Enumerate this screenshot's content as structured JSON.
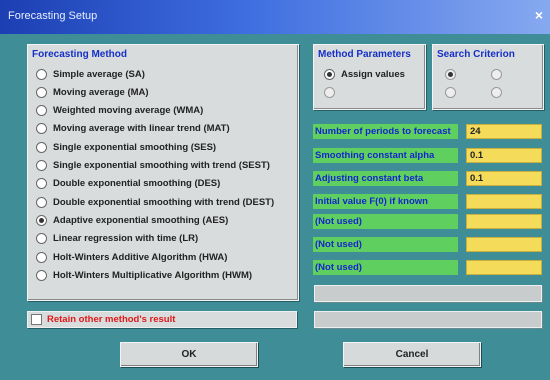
{
  "window": {
    "title": "Forecasting Setup",
    "close_label": "×"
  },
  "method_group": {
    "label": "Forecasting Method",
    "selected_index": 8,
    "options": [
      "Simple average (SA)",
      "Moving average (MA)",
      "Weighted moving average (WMA)",
      "Moving average with linear trend (MAT)",
      "Single exponential smoothing (SES)",
      "Single exponential smoothing with trend (SEST)",
      "Double exponential smoothing (DES)",
      "Double exponential smoothing with trend (DEST)",
      "Adaptive exponential smoothing (AES)",
      "Linear regression with time (LR)",
      "Holt-Winters Additive Algorithm (HWA)",
      "Holt-Winters Multiplicative Algorithm (HWM)"
    ]
  },
  "method_params": {
    "label": "Method Parameters",
    "option_assign": "Assign values",
    "option_search": ""
  },
  "search_criterion": {
    "label": "Search Criterion",
    "opt1": "",
    "opt2": "",
    "opt3": "",
    "opt4": ""
  },
  "params": {
    "rows": [
      {
        "label": "Number of periods to forecast",
        "value": "24"
      },
      {
        "label": "Smoothing constant alpha",
        "value": "0.1"
      },
      {
        "label": "Adjusting constant beta",
        "value": "0.1"
      },
      {
        "label": "Initial value F(0) if known",
        "value": ""
      },
      {
        "label": "(Not used)",
        "value": ""
      },
      {
        "label": "(Not used)",
        "value": ""
      },
      {
        "label": "(Not used)",
        "value": ""
      }
    ]
  },
  "disabled_buttons": {
    "top": "",
    "bottom": ""
  },
  "retain": {
    "label": "Retain other method's result"
  },
  "buttons": {
    "ok": "OK",
    "cancel": "Cancel"
  },
  "colors": {
    "param_label_bg": "#5fd05f",
    "param_input_bg": "#f4dc5a",
    "group_label": "#1530c8",
    "retain_text": "#e01818"
  }
}
